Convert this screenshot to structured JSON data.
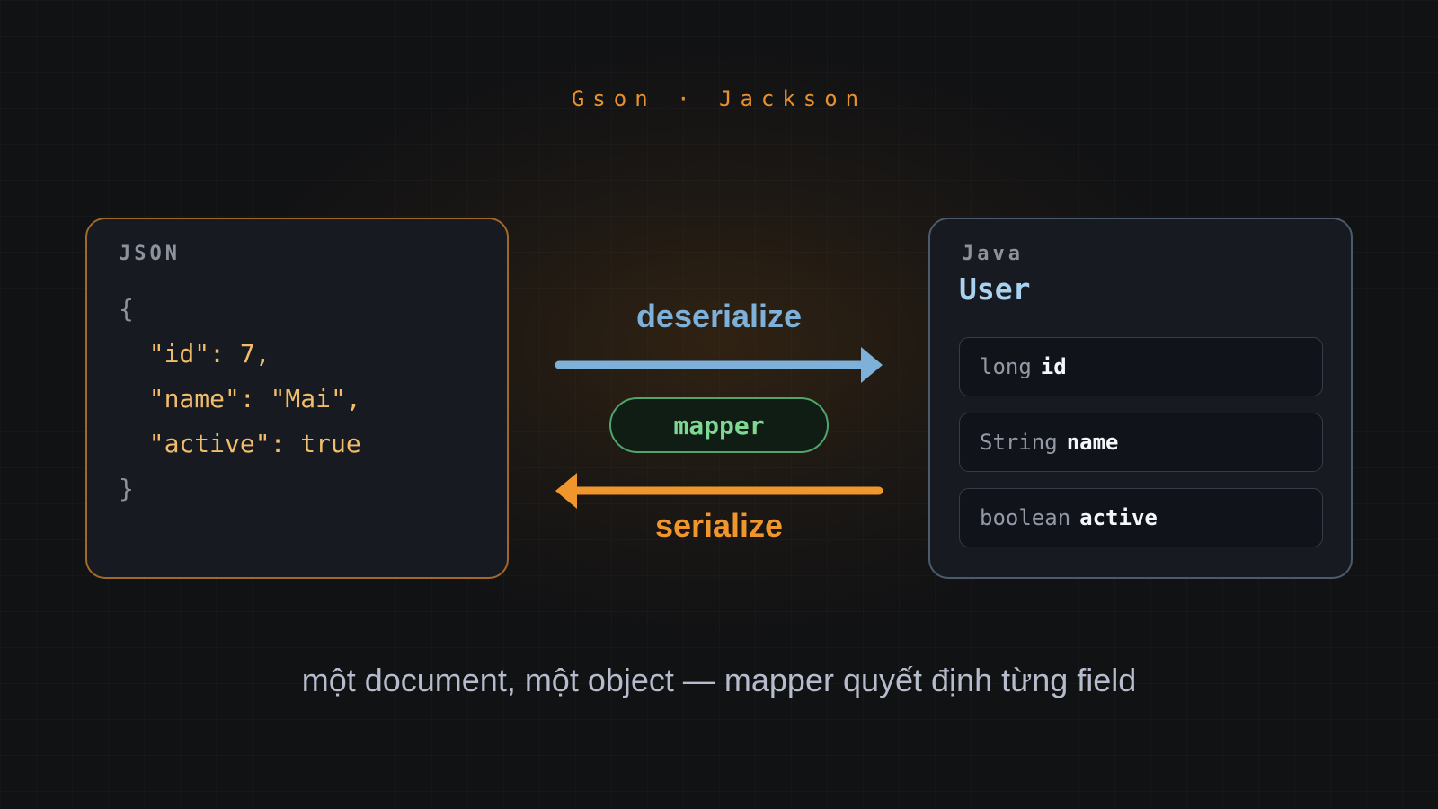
{
  "kicker": "Gson · Jackson",
  "json_panel": {
    "label": "JSON",
    "lines": [
      "{",
      "  \"id\": 7,",
      "  \"name\": \"Mai\",",
      "  \"active\": true",
      "}"
    ]
  },
  "java_panel": {
    "label": "Java",
    "class_name": "User",
    "fields": [
      {
        "type": "long",
        "name": "id"
      },
      {
        "type": "String",
        "name": "name"
      },
      {
        "type": "boolean",
        "name": "active"
      }
    ]
  },
  "arrows": {
    "deserialize": "deserialize",
    "serialize": "serialize",
    "mapper": "mapper"
  },
  "caption": "một document, một object — mapper quyết định từng field",
  "colors": {
    "json_accent": "#f2bd6a",
    "deserialize_arrow": "#7eb1d9",
    "serialize_arrow": "#f0962c",
    "mapper_green": "#7ed793"
  }
}
